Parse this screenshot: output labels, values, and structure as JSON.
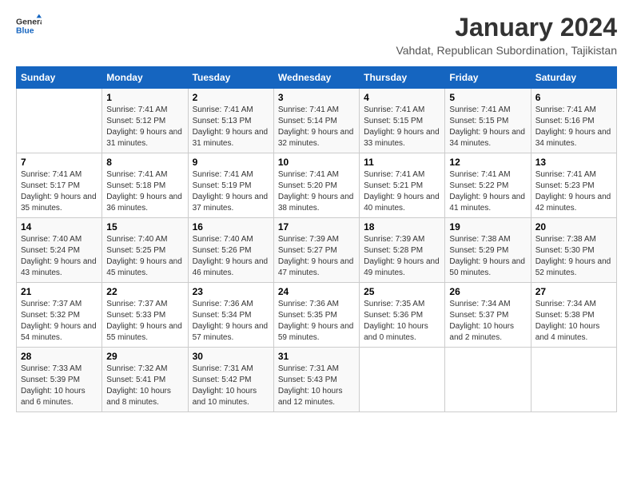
{
  "logo": {
    "general": "General",
    "blue": "Blue"
  },
  "header": {
    "month": "January 2024",
    "subtitle": "Vahdat, Republican Subordination, Tajikistan"
  },
  "columns": [
    "Sunday",
    "Monday",
    "Tuesday",
    "Wednesday",
    "Thursday",
    "Friday",
    "Saturday"
  ],
  "weeks": [
    [
      {
        "day": "",
        "sunrise": "",
        "sunset": "",
        "daylight": ""
      },
      {
        "day": "1",
        "sunrise": "Sunrise: 7:41 AM",
        "sunset": "Sunset: 5:12 PM",
        "daylight": "Daylight: 9 hours and 31 minutes."
      },
      {
        "day": "2",
        "sunrise": "Sunrise: 7:41 AM",
        "sunset": "Sunset: 5:13 PM",
        "daylight": "Daylight: 9 hours and 31 minutes."
      },
      {
        "day": "3",
        "sunrise": "Sunrise: 7:41 AM",
        "sunset": "Sunset: 5:14 PM",
        "daylight": "Daylight: 9 hours and 32 minutes."
      },
      {
        "day": "4",
        "sunrise": "Sunrise: 7:41 AM",
        "sunset": "Sunset: 5:15 PM",
        "daylight": "Daylight: 9 hours and 33 minutes."
      },
      {
        "day": "5",
        "sunrise": "Sunrise: 7:41 AM",
        "sunset": "Sunset: 5:15 PM",
        "daylight": "Daylight: 9 hours and 34 minutes."
      },
      {
        "day": "6",
        "sunrise": "Sunrise: 7:41 AM",
        "sunset": "Sunset: 5:16 PM",
        "daylight": "Daylight: 9 hours and 34 minutes."
      }
    ],
    [
      {
        "day": "7",
        "sunrise": "Sunrise: 7:41 AM",
        "sunset": "Sunset: 5:17 PM",
        "daylight": "Daylight: 9 hours and 35 minutes."
      },
      {
        "day": "8",
        "sunrise": "Sunrise: 7:41 AM",
        "sunset": "Sunset: 5:18 PM",
        "daylight": "Daylight: 9 hours and 36 minutes."
      },
      {
        "day": "9",
        "sunrise": "Sunrise: 7:41 AM",
        "sunset": "Sunset: 5:19 PM",
        "daylight": "Daylight: 9 hours and 37 minutes."
      },
      {
        "day": "10",
        "sunrise": "Sunrise: 7:41 AM",
        "sunset": "Sunset: 5:20 PM",
        "daylight": "Daylight: 9 hours and 38 minutes."
      },
      {
        "day": "11",
        "sunrise": "Sunrise: 7:41 AM",
        "sunset": "Sunset: 5:21 PM",
        "daylight": "Daylight: 9 hours and 40 minutes."
      },
      {
        "day": "12",
        "sunrise": "Sunrise: 7:41 AM",
        "sunset": "Sunset: 5:22 PM",
        "daylight": "Daylight: 9 hours and 41 minutes."
      },
      {
        "day": "13",
        "sunrise": "Sunrise: 7:41 AM",
        "sunset": "Sunset: 5:23 PM",
        "daylight": "Daylight: 9 hours and 42 minutes."
      }
    ],
    [
      {
        "day": "14",
        "sunrise": "Sunrise: 7:40 AM",
        "sunset": "Sunset: 5:24 PM",
        "daylight": "Daylight: 9 hours and 43 minutes."
      },
      {
        "day": "15",
        "sunrise": "Sunrise: 7:40 AM",
        "sunset": "Sunset: 5:25 PM",
        "daylight": "Daylight: 9 hours and 45 minutes."
      },
      {
        "day": "16",
        "sunrise": "Sunrise: 7:40 AM",
        "sunset": "Sunset: 5:26 PM",
        "daylight": "Daylight: 9 hours and 46 minutes."
      },
      {
        "day": "17",
        "sunrise": "Sunrise: 7:39 AM",
        "sunset": "Sunset: 5:27 PM",
        "daylight": "Daylight: 9 hours and 47 minutes."
      },
      {
        "day": "18",
        "sunrise": "Sunrise: 7:39 AM",
        "sunset": "Sunset: 5:28 PM",
        "daylight": "Daylight: 9 hours and 49 minutes."
      },
      {
        "day": "19",
        "sunrise": "Sunrise: 7:38 AM",
        "sunset": "Sunset: 5:29 PM",
        "daylight": "Daylight: 9 hours and 50 minutes."
      },
      {
        "day": "20",
        "sunrise": "Sunrise: 7:38 AM",
        "sunset": "Sunset: 5:30 PM",
        "daylight": "Daylight: 9 hours and 52 minutes."
      }
    ],
    [
      {
        "day": "21",
        "sunrise": "Sunrise: 7:37 AM",
        "sunset": "Sunset: 5:32 PM",
        "daylight": "Daylight: 9 hours and 54 minutes."
      },
      {
        "day": "22",
        "sunrise": "Sunrise: 7:37 AM",
        "sunset": "Sunset: 5:33 PM",
        "daylight": "Daylight: 9 hours and 55 minutes."
      },
      {
        "day": "23",
        "sunrise": "Sunrise: 7:36 AM",
        "sunset": "Sunset: 5:34 PM",
        "daylight": "Daylight: 9 hours and 57 minutes."
      },
      {
        "day": "24",
        "sunrise": "Sunrise: 7:36 AM",
        "sunset": "Sunset: 5:35 PM",
        "daylight": "Daylight: 9 hours and 59 minutes."
      },
      {
        "day": "25",
        "sunrise": "Sunrise: 7:35 AM",
        "sunset": "Sunset: 5:36 PM",
        "daylight": "Daylight: 10 hours and 0 minutes."
      },
      {
        "day": "26",
        "sunrise": "Sunrise: 7:34 AM",
        "sunset": "Sunset: 5:37 PM",
        "daylight": "Daylight: 10 hours and 2 minutes."
      },
      {
        "day": "27",
        "sunrise": "Sunrise: 7:34 AM",
        "sunset": "Sunset: 5:38 PM",
        "daylight": "Daylight: 10 hours and 4 minutes."
      }
    ],
    [
      {
        "day": "28",
        "sunrise": "Sunrise: 7:33 AM",
        "sunset": "Sunset: 5:39 PM",
        "daylight": "Daylight: 10 hours and 6 minutes."
      },
      {
        "day": "29",
        "sunrise": "Sunrise: 7:32 AM",
        "sunset": "Sunset: 5:41 PM",
        "daylight": "Daylight: 10 hours and 8 minutes."
      },
      {
        "day": "30",
        "sunrise": "Sunrise: 7:31 AM",
        "sunset": "Sunset: 5:42 PM",
        "daylight": "Daylight: 10 hours and 10 minutes."
      },
      {
        "day": "31",
        "sunrise": "Sunrise: 7:31 AM",
        "sunset": "Sunset: 5:43 PM",
        "daylight": "Daylight: 10 hours and 12 minutes."
      },
      {
        "day": "",
        "sunrise": "",
        "sunset": "",
        "daylight": ""
      },
      {
        "day": "",
        "sunrise": "",
        "sunset": "",
        "daylight": ""
      },
      {
        "day": "",
        "sunrise": "",
        "sunset": "",
        "daylight": ""
      }
    ]
  ]
}
